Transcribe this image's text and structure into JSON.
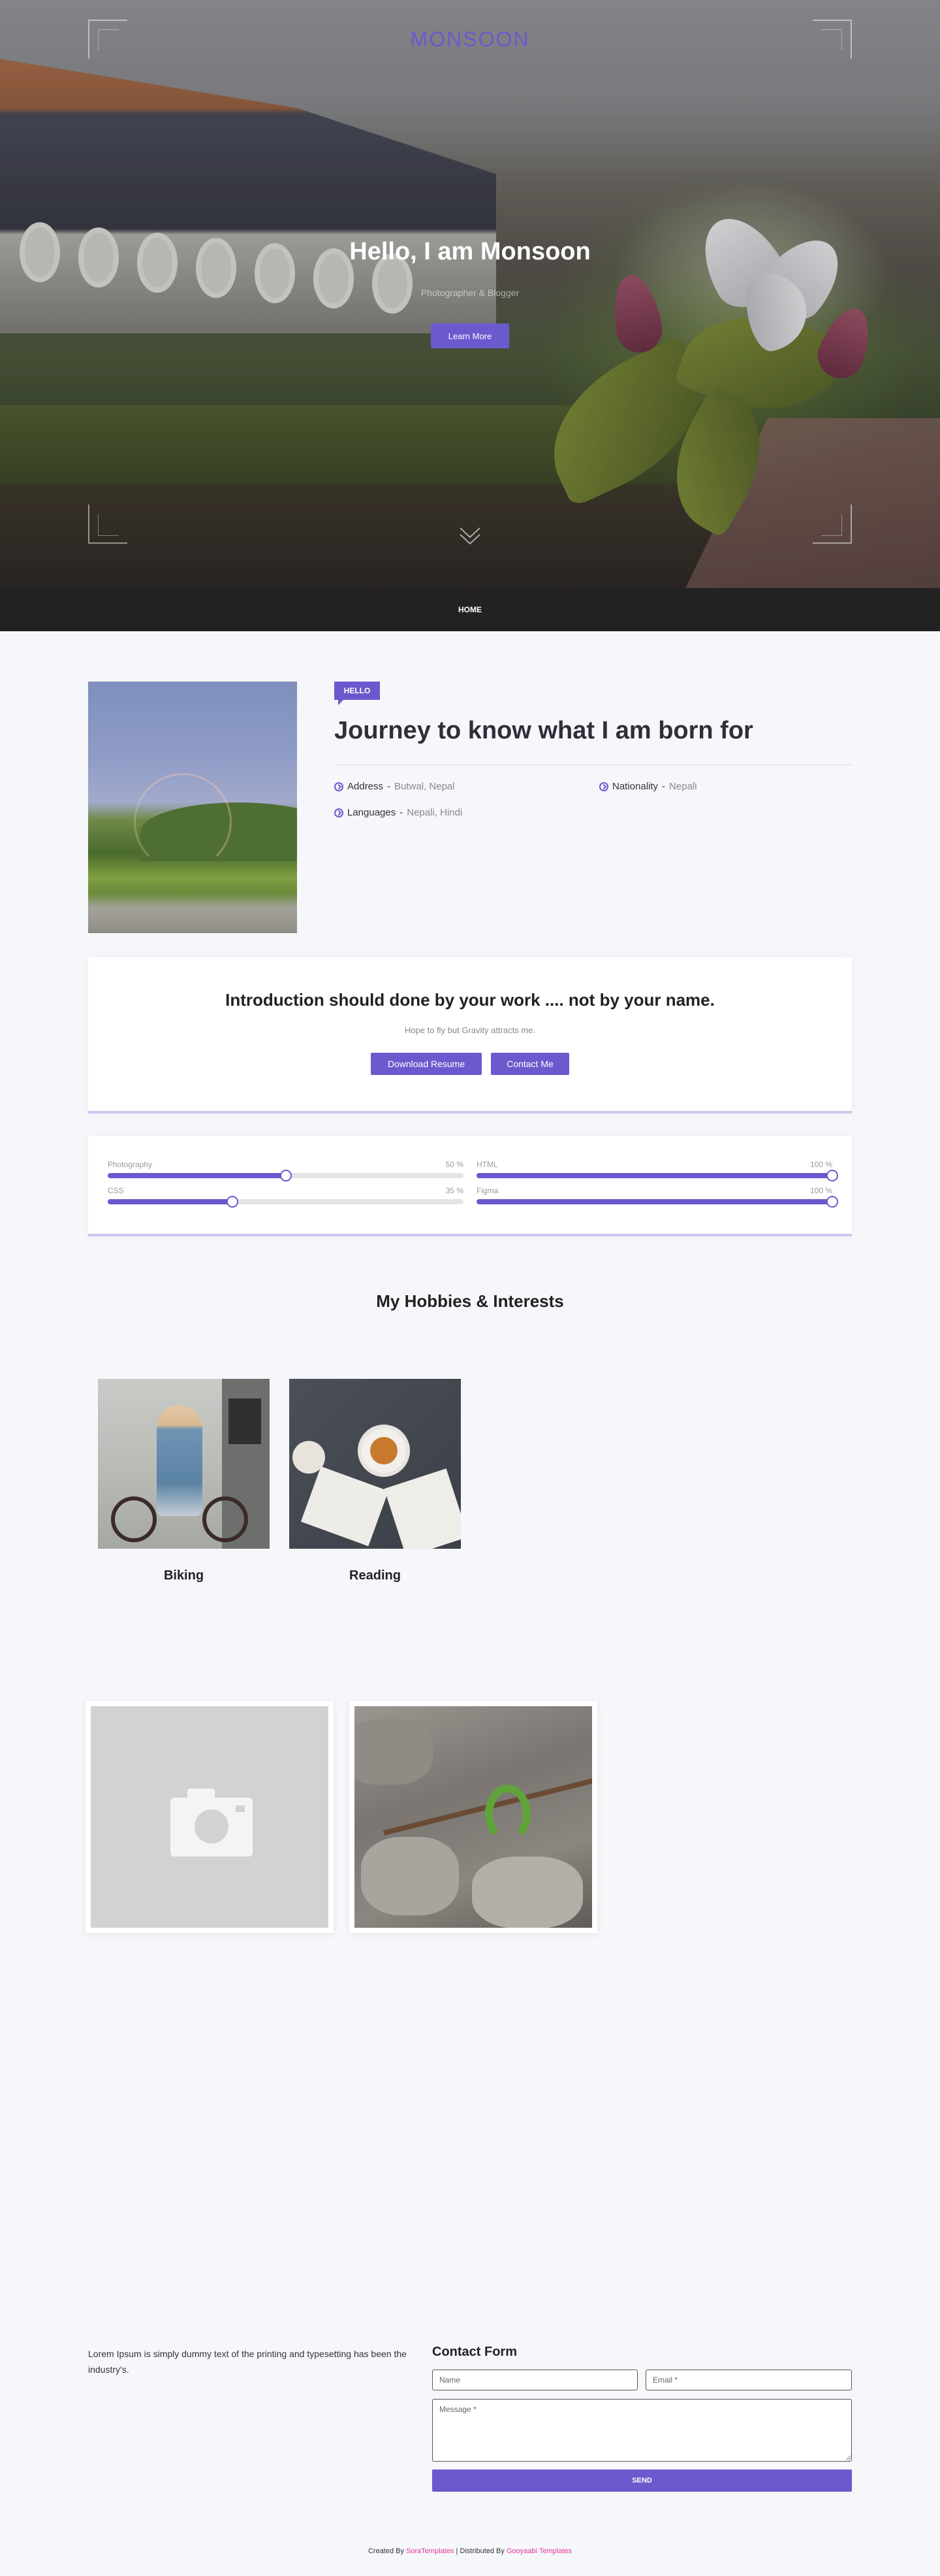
{
  "hero": {
    "brand": "MONSOON",
    "title": "Hello, I am Monsoon",
    "subtitle": "Photographer & Blogger",
    "cta_label": "Learn More"
  },
  "nav": {
    "home_label": "HOME"
  },
  "about": {
    "badge": "HELLO",
    "title": "Journey to know what I am born for",
    "info": [
      {
        "label": "Address",
        "separator": " - ",
        "value": "Butwal, Nepal"
      },
      {
        "label": "Nationality",
        "separator": " - ",
        "value": "Nepali"
      },
      {
        "label": "Languages",
        "separator": " - ",
        "value": "Nepali, Hindi"
      }
    ]
  },
  "intro": {
    "title": "Introduction should done by your work .... not by your name.",
    "subtitle": "Hope to fly but Gravity attracts me.",
    "download_label": "Download Resume",
    "contact_label": "Contact Me"
  },
  "skills": [
    {
      "name": "Photography",
      "percent_label": "50 %",
      "value": 50
    },
    {
      "name": "HTML",
      "percent_label": "100 %",
      "value": 100
    },
    {
      "name": "CSS",
      "percent_label": "35 %",
      "value": 35
    },
    {
      "name": "Figma",
      "percent_label": "100 %",
      "value": 100
    }
  ],
  "hobbies": {
    "title": "My Hobbies & Interests",
    "items": [
      {
        "label": "Biking"
      },
      {
        "label": "Reading"
      }
    ]
  },
  "footer": {
    "text": "Lorem Ipsum is simply dummy text of the printing and typesetting has been the industry's.",
    "contact_title": "Contact Form",
    "name_placeholder": "Name",
    "email_placeholder": "Email *",
    "message_placeholder": "Message *",
    "send_label": "SEND",
    "credits": {
      "created_prefix": "Created By ",
      "created_link": "SoraTemplates",
      "separator": " | Distributed By ",
      "distributed_link": "Gooyaabi Templates"
    }
  },
  "colors": {
    "accent": "#6a5acd",
    "nav_bg": "#222222",
    "page_bg": "#f6f7fb",
    "credit_link": "#e0389a"
  }
}
